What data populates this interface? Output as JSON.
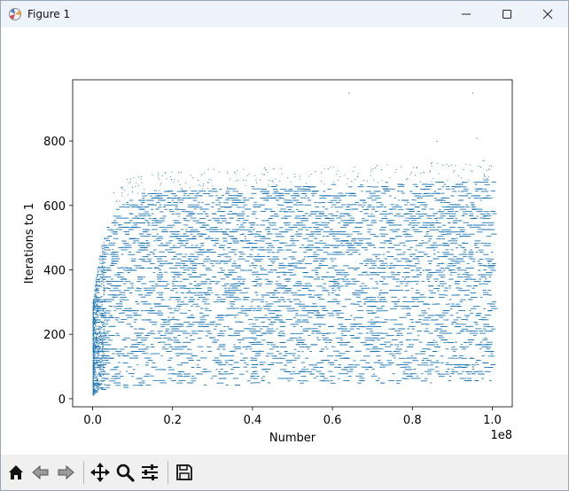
{
  "window": {
    "title": "Figure 1",
    "controls": [
      "minimize",
      "maximize",
      "close"
    ]
  },
  "toolbar": {
    "buttons": [
      {
        "icon": "home-icon",
        "label": "Home"
      },
      {
        "icon": "back-arrow-icon",
        "label": "Back"
      },
      {
        "icon": "forward-arrow-icon",
        "label": "Forward"
      },
      {
        "icon": "pan-icon",
        "label": "Pan"
      },
      {
        "icon": "zoom-icon",
        "label": "Zoom"
      },
      {
        "icon": "configure-subplots-icon",
        "label": "Subplots"
      },
      {
        "icon": "save-icon",
        "label": "Save"
      }
    ]
  },
  "chart_data": {
    "type": "scatter",
    "title": "",
    "xlabel": "Number",
    "ylabel": "Iterations to 1",
    "x_offset_label": "1e8",
    "xlim": [
      -0.05,
      1.05
    ],
    "ylim": [
      -25,
      990
    ],
    "x_ticks": [
      0.0,
      0.2,
      0.4,
      0.6,
      0.8,
      1.0
    ],
    "x_tick_labels": [
      "0.0",
      "0.2",
      "0.4",
      "0.6",
      "0.8",
      "1.0"
    ],
    "y_ticks": [
      0,
      200,
      400,
      600,
      800
    ],
    "y_tick_labels": [
      "0",
      "200",
      "400",
      "600",
      "800"
    ],
    "grid": false,
    "legend": "none",
    "marker_color": "#1f77b4",
    "series": [
      {
        "description_points": [
          [
            0.0,
            0
          ],
          [
            0.0,
            300
          ],
          [
            0.005,
            450
          ],
          [
            0.02,
            560
          ],
          [
            0.05,
            620
          ],
          [
            0.1,
            650
          ],
          [
            0.3,
            660
          ],
          [
            0.6,
            680
          ],
          [
            1.0,
            690
          ],
          [
            0.64,
            950
          ],
          [
            0.95,
            950
          ],
          [
            0.86,
            800
          ],
          [
            0.96,
            810
          ]
        ]
      }
    ]
  }
}
